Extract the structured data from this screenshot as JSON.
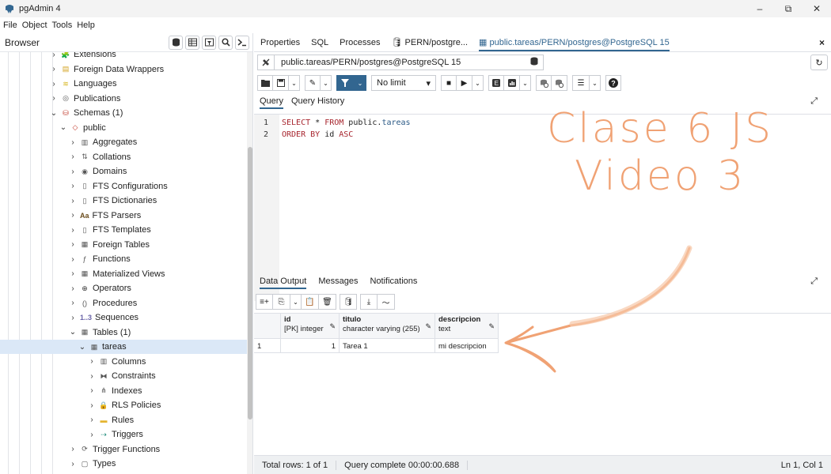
{
  "app": {
    "title": "pgAdmin 4",
    "window_controls": [
      "–",
      "⧉",
      "✕"
    ]
  },
  "menu": [
    "File",
    "Object",
    "Tools",
    "Help"
  ],
  "sidebar": {
    "title": "Browser",
    "tree": [
      {
        "label": "Extensions",
        "icon": "extensions-icon",
        "chevron": "›"
      },
      {
        "label": "Foreign Data Wrappers",
        "icon": "fdw-icon",
        "chevron": "›"
      },
      {
        "label": "Languages",
        "icon": "languages-icon",
        "chevron": "›"
      },
      {
        "label": "Publications",
        "icon": "publications-icon",
        "chevron": "›"
      },
      {
        "label": "Schemas (1)",
        "icon": "schemas-icon",
        "chevron": "⌄"
      },
      {
        "label": "public",
        "icon": "schema-icon",
        "chevron": "⌄"
      },
      {
        "label": "Aggregates",
        "icon": "aggregates-icon",
        "chevron": "›"
      },
      {
        "label": "Collations",
        "icon": "collations-icon",
        "chevron": "›"
      },
      {
        "label": "Domains",
        "icon": "domains-icon",
        "chevron": "›"
      },
      {
        "label": "FTS Configurations",
        "icon": "fts-config-icon",
        "chevron": "›"
      },
      {
        "label": "FTS Dictionaries",
        "icon": "fts-dict-icon",
        "chevron": "›"
      },
      {
        "label": "FTS Parsers",
        "icon": "fts-parsers-icon",
        "chevron": "›",
        "icon_text": "Aa"
      },
      {
        "label": "FTS Templates",
        "icon": "fts-templates-icon",
        "chevron": "›"
      },
      {
        "label": "Foreign Tables",
        "icon": "foreign-tables-icon",
        "chevron": "›"
      },
      {
        "label": "Functions",
        "icon": "functions-icon",
        "chevron": "›"
      },
      {
        "label": "Materialized Views",
        "icon": "mviews-icon",
        "chevron": "›"
      },
      {
        "label": "Operators",
        "icon": "operators-icon",
        "chevron": "›"
      },
      {
        "label": "Procedures",
        "icon": "procedures-icon",
        "chevron": "›"
      },
      {
        "label": "Sequences",
        "icon": "sequences-icon",
        "chevron": "›",
        "icon_text": "1..3"
      },
      {
        "label": "Tables (1)",
        "icon": "tables-icon",
        "chevron": "⌄"
      },
      {
        "label": "tareas",
        "icon": "table-icon",
        "chevron": "⌄"
      },
      {
        "label": "Columns",
        "icon": "columns-icon",
        "chevron": "›"
      },
      {
        "label": "Constraints",
        "icon": "constraints-icon",
        "chevron": "›"
      },
      {
        "label": "Indexes",
        "icon": "indexes-icon",
        "chevron": "›"
      },
      {
        "label": "RLS Policies",
        "icon": "rls-icon",
        "chevron": "›"
      },
      {
        "label": "Rules",
        "icon": "rules-icon",
        "chevron": "›"
      },
      {
        "label": "Triggers",
        "icon": "triggers-icon",
        "chevron": "›"
      },
      {
        "label": "Trigger Functions",
        "icon": "trigger-functions-icon",
        "chevron": "›"
      },
      {
        "label": "Types",
        "icon": "types-icon",
        "chevron": "›"
      }
    ]
  },
  "tabs": [
    {
      "label": "Properties"
    },
    {
      "label": "SQL"
    },
    {
      "label": "Processes"
    },
    {
      "label": "PERN/postgre..."
    },
    {
      "label": "public.tareas/PERN/postgres@PostgreSQL 15"
    }
  ],
  "tab_close": "×",
  "connection": {
    "value": "public.tareas/PERN/postgres@PostgreSQL 15"
  },
  "toolbar": {
    "limit_label": "No limit"
  },
  "query_tabs": [
    "Query",
    "Query History"
  ],
  "editor": {
    "line_numbers": [
      "1",
      "2"
    ]
  },
  "overlay": {
    "line1": "Clase 6 JS",
    "line2": "Video 3",
    "color": "#f0a274"
  },
  "output_tabs": [
    "Data Output",
    "Messages",
    "Notifications"
  ],
  "grid": {
    "columns": [
      {
        "name": "id",
        "type": "[PK] integer"
      },
      {
        "name": "titulo",
        "type": "character varying (255)"
      },
      {
        "name": "descripcion",
        "type": "text"
      }
    ],
    "rows": [
      {
        "row_num": "1",
        "id": "1",
        "titulo": "Tarea 1",
        "descripcion": "mi descripcion"
      }
    ]
  },
  "status": {
    "total_rows": "Total rows: 1 of 1",
    "query_time": "Query complete 00:00:00.688",
    "cursor": "Ln 1, Col 1"
  }
}
